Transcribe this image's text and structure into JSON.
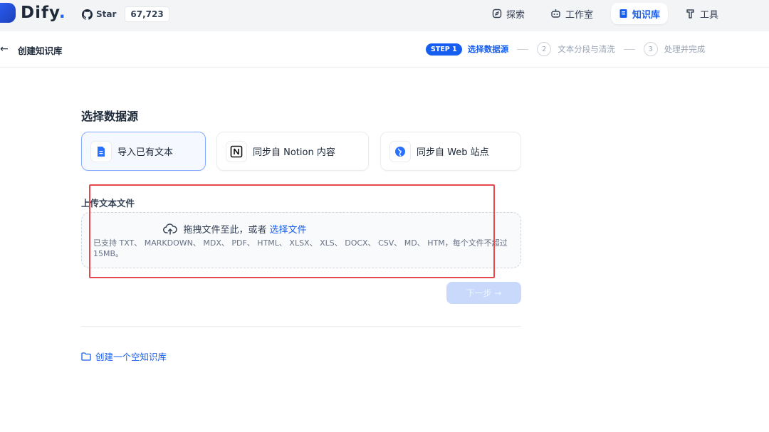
{
  "brand": {
    "name": "Dify",
    "dot": "."
  },
  "github": {
    "star_label": "Star",
    "count": "67,723"
  },
  "nav": {
    "items": [
      {
        "label": "探索",
        "icon": "compass-icon"
      },
      {
        "label": "工作室",
        "icon": "robot-icon"
      },
      {
        "label": "知识库",
        "icon": "book-icon",
        "active": true
      },
      {
        "label": "工具",
        "icon": "hammer-icon"
      }
    ]
  },
  "header": {
    "back_icon": "arrow-left-icon",
    "back_glyph": "←",
    "title": "创建知识库"
  },
  "steps": {
    "active_badge": "STEP 1",
    "active_label": "选择数据源",
    "items": [
      {
        "num": "2",
        "label": "文本分段与清洗"
      },
      {
        "num": "3",
        "label": "处理并完成"
      }
    ]
  },
  "datasource": {
    "title": "选择数据源",
    "options": [
      {
        "label": "导入已有文本",
        "icon": "file-text-icon",
        "selected": true
      },
      {
        "label": "同步自 Notion 内容",
        "icon": "notion-icon"
      },
      {
        "label": "同步自 Web 站点",
        "icon": "globe-icon"
      }
    ]
  },
  "upload": {
    "label": "上传文本文件",
    "drop_text": "拖拽文件至此，或者",
    "select_link": "选择文件",
    "hint": "已支持 TXT、 MARKDOWN、 MDX、 PDF、 HTML、 XLSX、 XLS、 DOCX、 CSV、 MD、 HTM，每个文件不超过 15MB。"
  },
  "next_button": "下一步 →",
  "create_empty": "创建一个空知识库",
  "colors": {
    "accent": "#155eef",
    "highlight_box": "#e5484d",
    "topbar_bg": "#f3f4f6"
  }
}
